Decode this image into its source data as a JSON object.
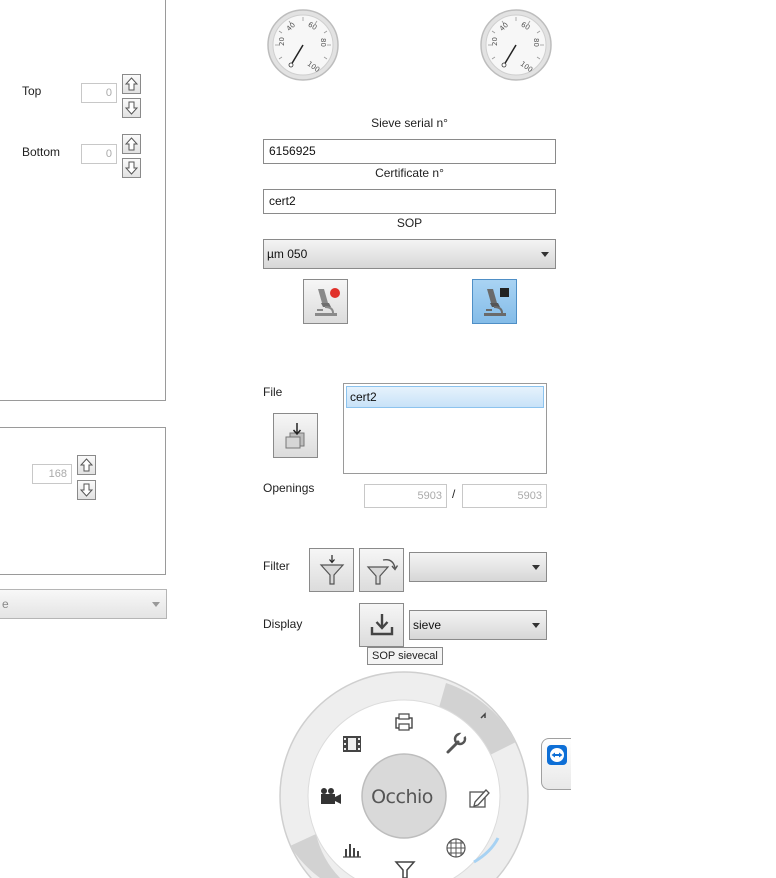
{
  "left": {
    "top_label": "Top",
    "top_value": "0",
    "bottom_label": "Bottom",
    "bottom_value": "0",
    "mid_value": "168",
    "dropdown_value": "e"
  },
  "gauges": {
    "left": {
      "ticks": [
        "20",
        "40",
        "60",
        "80",
        "100"
      ]
    },
    "right": {
      "ticks": [
        "20",
        "40",
        "60",
        "80",
        "100"
      ]
    }
  },
  "form": {
    "sieve_serial_label": "Sieve serial n°",
    "sieve_serial_value": "6156925",
    "certificate_label": "Certificate n°",
    "certificate_value": "cert2",
    "sop_label": "SOP",
    "sop_value": "µm 050"
  },
  "file": {
    "label": "File",
    "items": [
      "cert2"
    ]
  },
  "openings": {
    "label": "Openings",
    "value1": "5903",
    "separator": "/",
    "value2": "5903"
  },
  "filter": {
    "label": "Filter",
    "value": ""
  },
  "display": {
    "label": "Display",
    "value": "sieve",
    "tooltip": "SOP sievecal"
  },
  "radial": {
    "brand": "Occhio"
  },
  "colors": {
    "accent_blue": "#8cc3ee",
    "record_red": "#e0302a",
    "selection_blue": "#cfe6fa"
  }
}
